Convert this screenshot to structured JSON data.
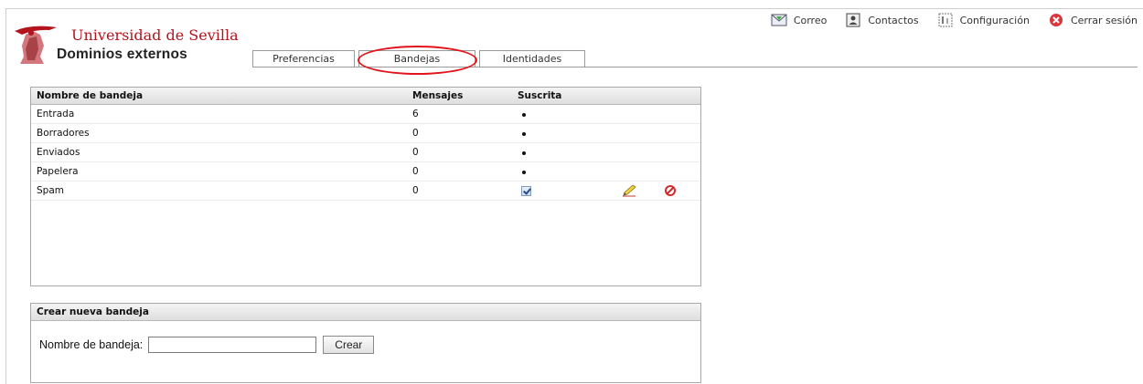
{
  "logo": {
    "title": "Universidad de Sevilla",
    "subtitle": "Dominios externos"
  },
  "toolbar": {
    "items": [
      {
        "label": "Correo",
        "icon": "mail-icon"
      },
      {
        "label": "Contactos",
        "icon": "contacts-icon"
      },
      {
        "label": "Configuración",
        "icon": "settings-icon"
      },
      {
        "label": "Cerrar sesión",
        "icon": "logout-icon"
      }
    ]
  },
  "tabs": [
    {
      "label": "Preferencias",
      "active": false
    },
    {
      "label": "Bandejas",
      "active": true
    },
    {
      "label": "Identidades",
      "active": false
    }
  ],
  "folders": {
    "headers": {
      "name": "Nombre de bandeja",
      "messages": "Mensajes",
      "subscribed": "Suscrita"
    },
    "rows": [
      {
        "name": "Entrada",
        "messages": "6",
        "subscribed": "bullet"
      },
      {
        "name": "Borradores",
        "messages": "0",
        "subscribed": "bullet"
      },
      {
        "name": "Enviados",
        "messages": "0",
        "subscribed": "bullet"
      },
      {
        "name": "Papelera",
        "messages": "0",
        "subscribed": "bullet"
      },
      {
        "name": "Spam",
        "messages": "0",
        "subscribed": "checkbox-checked",
        "actions": [
          "rename-icon",
          "delete-icon"
        ]
      }
    ]
  },
  "new_folder": {
    "title": "Crear nueva bandeja",
    "field_label": "Nombre de bandeja:",
    "field_value": "",
    "button_label": "Crear"
  },
  "colors": {
    "accent_red": "#b3141e",
    "highlight_oval": "#e3141b",
    "border": "#a9a9a9"
  }
}
